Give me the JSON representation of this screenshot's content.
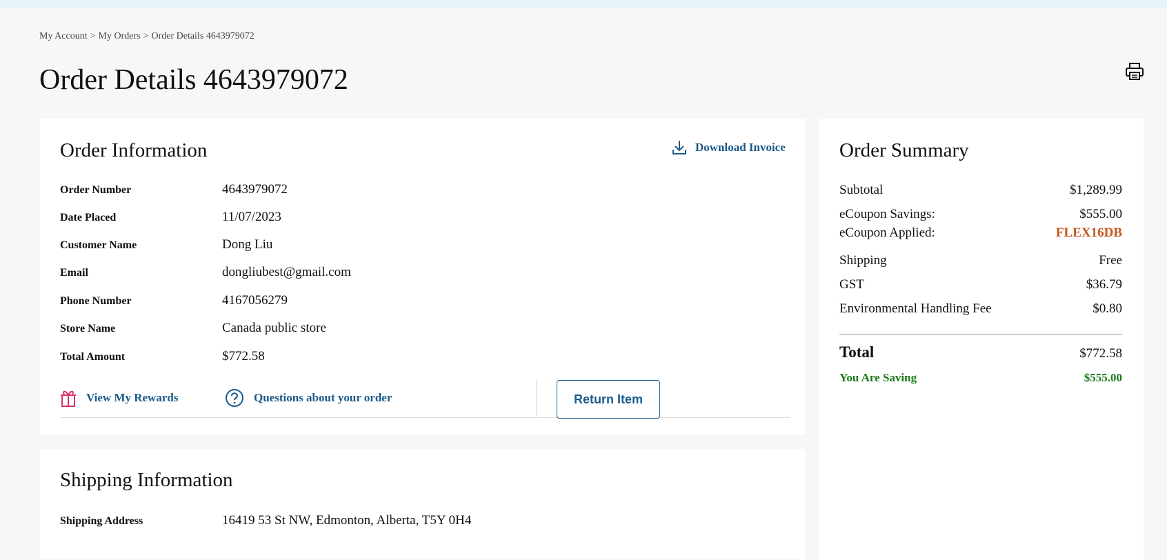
{
  "breadcrumb": {
    "items": [
      "My Account",
      "My Orders",
      "Order Details 4643979072"
    ],
    "separator": ">"
  },
  "page": {
    "title": "Order Details 4643979072"
  },
  "order_info": {
    "title": "Order Information",
    "download_label": "Download Invoice",
    "fields": [
      {
        "label": "Order Number",
        "value": "4643979072"
      },
      {
        "label": "Date Placed",
        "value": "11/07/2023"
      },
      {
        "label": "Customer Name",
        "value": "Dong Liu"
      },
      {
        "label": "Email",
        "value": "dongliubest@gmail.com"
      },
      {
        "label": "Phone Number",
        "value": "4167056279"
      },
      {
        "label": "Store Name",
        "value": "Canada public store"
      },
      {
        "label": "Total Amount",
        "value": "$772.58"
      }
    ],
    "actions": {
      "rewards_label": "View My Rewards",
      "questions_label": "Questions about your order",
      "return_label": "Return Item"
    }
  },
  "shipping_info": {
    "title": "Shipping Information",
    "address_label": "Shipping Address",
    "address_value": "16419 53 St NW, Edmonton, Alberta, T5Y 0H4"
  },
  "summary": {
    "title": "Order Summary",
    "subtotal_label": "Subtotal",
    "subtotal_value": "$1,289.99",
    "ecoupon_savings_label": "eCoupon Savings:",
    "ecoupon_savings_value": "$555.00",
    "ecoupon_applied_label": "eCoupon Applied:",
    "ecoupon_applied_value": "FLEX16DB",
    "shipping_label": "Shipping",
    "shipping_value": "Free",
    "gst_label": "GST",
    "gst_value": "$36.79",
    "env_fee_label": "Environmental Handling Fee",
    "env_fee_value": "$0.80",
    "total_label": "Total",
    "total_value": "$772.58",
    "saving_label": "You Are Saving",
    "saving_value": "$555.00"
  },
  "colors": {
    "link": "#1a5a8a",
    "coupon": "#c4541a",
    "saving": "#1a7a1a",
    "rewards_icon": "#d6336c"
  },
  "icons": {
    "print": "printer-icon",
    "download": "download-icon",
    "rewards": "gift-icon",
    "questions": "question-circle-icon"
  }
}
